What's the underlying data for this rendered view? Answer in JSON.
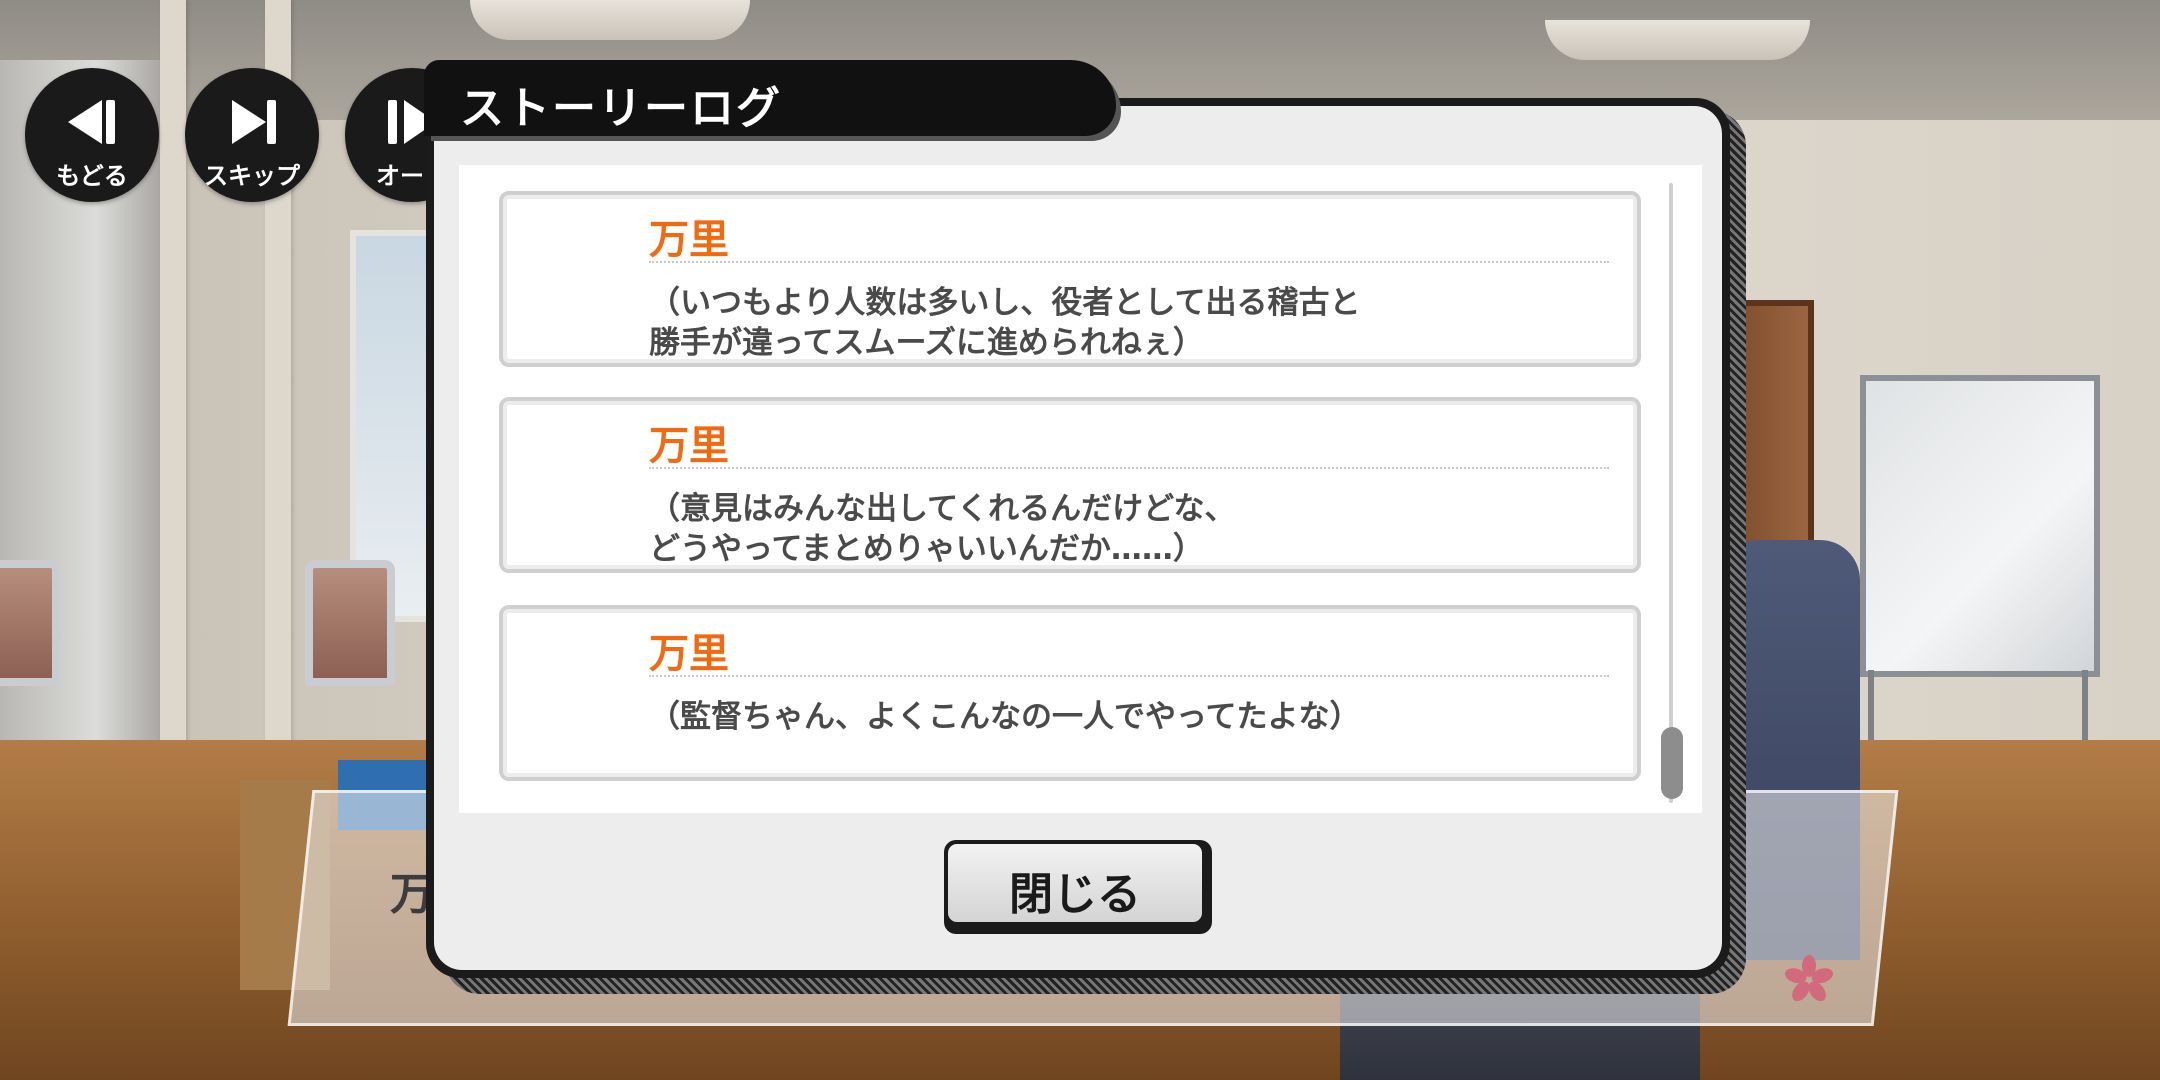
{
  "controls": {
    "back_label": "もどる",
    "skip_label": "スキップ",
    "auto_label": "オート"
  },
  "background": {
    "name_peek": "万"
  },
  "dialog": {
    "title": "ストーリーログ",
    "close_label": "閉じる",
    "entries": [
      {
        "speaker": "万里",
        "lines": [
          "（いつもより人数は多いし、役者として出る稽古と",
          "勝手が違ってスムーズに進められねぇ）"
        ]
      },
      {
        "speaker": "万里",
        "lines": [
          "（意見はみんな出してくれるんだけどな、",
          "どうやってまとめりゃいいんだか……）"
        ]
      },
      {
        "speaker": "万里",
        "lines": [
          "（監督ちゃん、よくこんなの一人でやってたよな）"
        ]
      }
    ]
  },
  "colors": {
    "speaker": "#f26a0f",
    "dialog_frame": "#1b1b1b",
    "dialog_bg": "#ededed",
    "text": "#4a4a4a"
  },
  "icons": {
    "back": "rewind-icon",
    "skip": "skip-icon",
    "auto": "play-pause-icon",
    "corner": "sakura-icon"
  }
}
